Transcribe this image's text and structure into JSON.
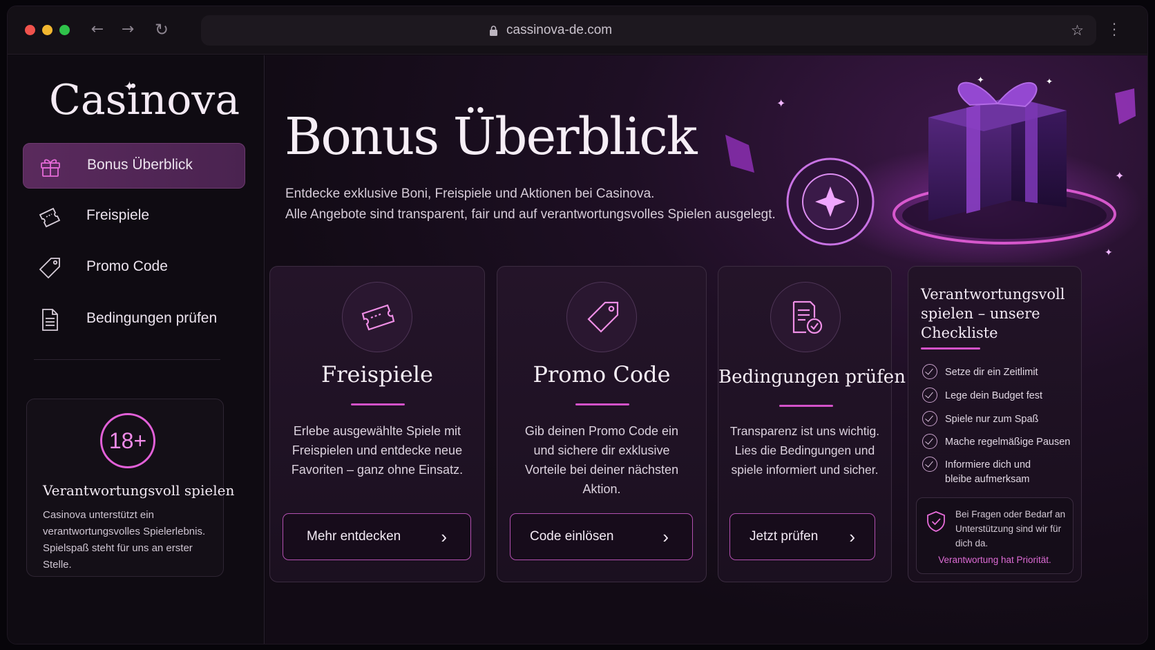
{
  "browser": {
    "url": "cassinova-de.com"
  },
  "sidebar": {
    "logo": "Casinova",
    "items": [
      {
        "label": "Bonus Überblick",
        "icon": "gift-icon",
        "active": true
      },
      {
        "label": "Freispiele",
        "icon": "ticket-icon",
        "active": false
      },
      {
        "label": "Promo Code",
        "icon": "tag-icon",
        "active": false
      },
      {
        "label": "Bedingungen prüfen",
        "icon": "document-icon",
        "active": false
      }
    ],
    "responsible": {
      "badge": "18+",
      "title": "Verantwortungsvoll spielen",
      "text": "Casinova unterstützt ein verantwortungsvolles Spielerlebnis. Spielspaß steht für uns an erster Stelle."
    }
  },
  "hero": {
    "title": "Bonus Überblick",
    "line1": "Entdecke exklusive Boni, Freispiele und Aktionen bei Casinova.",
    "line2": "Alle Angebote sind transparent, fair und auf verantwortungsvolles Spielen ausgelegt."
  },
  "cards": [
    {
      "title": "Freispiele",
      "icon": "ticket-icon",
      "text": "Erlebe ausgewählte Spiele mit Freispielen und entdecke neue Favoriten – ganz ohne Einsatz.",
      "button": "Mehr entdecken"
    },
    {
      "title": "Promo Code",
      "icon": "tag-icon",
      "text": "Gib deinen Promo Code ein und sichere dir exklusive Vorteile bei deiner nächsten Aktion.",
      "button": "Code einlösen"
    },
    {
      "title": "Bedingungen prüfen",
      "icon": "checklist-document-icon",
      "text": "Transparenz ist uns wichtig. Lies die Bedingungen und spiele informiert und sicher.",
      "button": "Jetzt prüfen"
    }
  ],
  "checklist": {
    "title": "Verantwortungsvoll spielen – unsere Checkliste",
    "items": [
      "Setze dir ein Zeitlimit",
      "Lege dein Budget fest",
      "Spiele nur zum Spaß",
      "Mache regelmäßige Pausen",
      "Informiere dich und bleibe aufmerksam"
    ],
    "support_text": "Bei Fragen oder Bedarf an Unterstützung sind wir für dich da.",
    "support_link": "Verantwortung hat Priorität."
  },
  "colors": {
    "accent": "#d452c9",
    "active_nav": "#5a2a5d",
    "background": "#120b15"
  }
}
